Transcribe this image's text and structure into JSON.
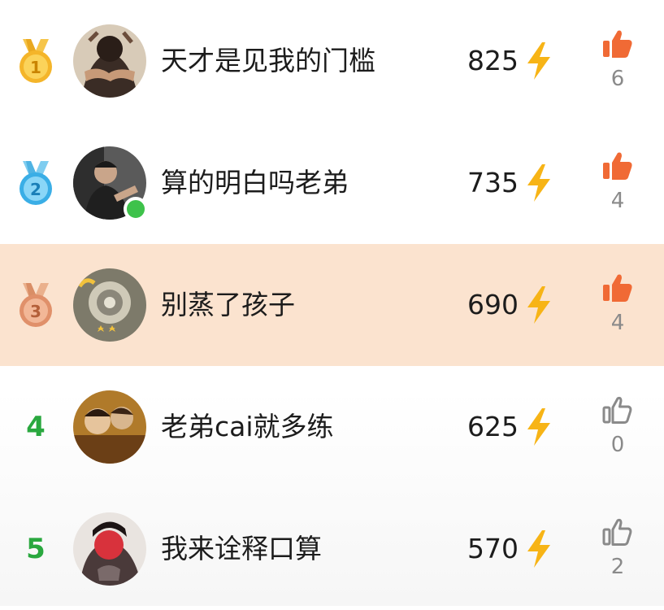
{
  "colors": {
    "highlight_row": "#fbe3cf",
    "like_active": "#f06a35",
    "like_inactive": "#8a8a8a",
    "rank_number": "#2aa83f",
    "bolt": "#f7b416",
    "online": "#3ec24b"
  },
  "entries": [
    {
      "rank": "1",
      "rank_badge": "gold-medal-icon",
      "name": "天才是见我的门槛",
      "score": "825",
      "likes": "6",
      "liked": true,
      "highlight": false,
      "online": false
    },
    {
      "rank": "2",
      "rank_badge": "blue-medal-icon",
      "name": "算的明白吗老弟",
      "score": "735",
      "likes": "4",
      "liked": true,
      "highlight": false,
      "online": true
    },
    {
      "rank": "3",
      "rank_badge": "bronze-medal-icon",
      "name": "别蒸了孩子",
      "score": "690",
      "likes": "4",
      "liked": true,
      "highlight": true,
      "online": false
    },
    {
      "rank": "4",
      "rank_badge": null,
      "name": "老弟cai就多练",
      "score": "625",
      "likes": "0",
      "liked": false,
      "highlight": false,
      "online": false
    },
    {
      "rank": "5",
      "rank_badge": null,
      "name": "我来诠释口算",
      "score": "570",
      "likes": "2",
      "liked": false,
      "highlight": false,
      "online": false
    }
  ]
}
